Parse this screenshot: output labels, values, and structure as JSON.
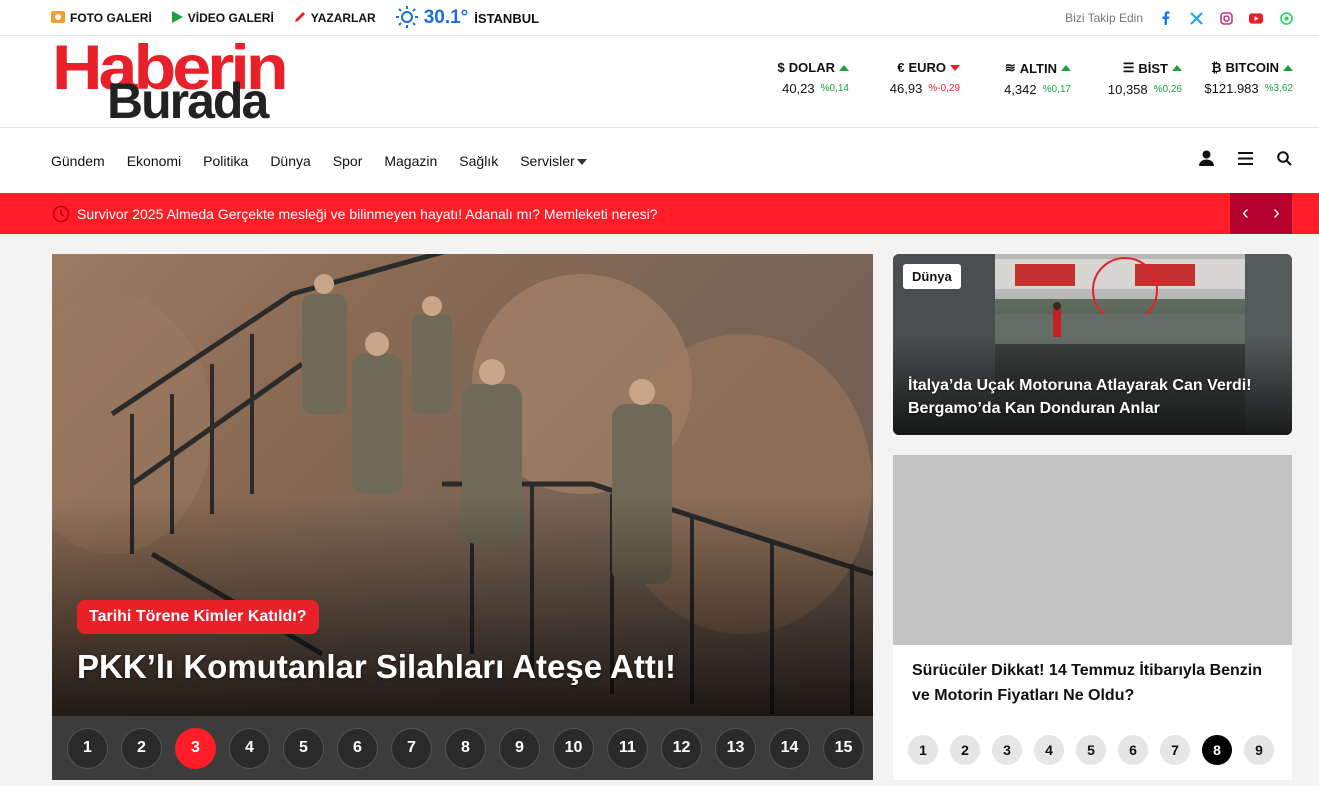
{
  "topbar": {
    "foto_galeri": "FOTO GALERİ",
    "video_galeri": "VİDEO GALERİ",
    "yazarlar": "YAZARLAR",
    "temperature": "30.1°",
    "city": "İSTANBUL",
    "follow": "Bizi Takip Edin",
    "social_icons": [
      "facebook-icon",
      "x-icon",
      "instagram-icon",
      "youtube-icon",
      "whatsapp-icon"
    ]
  },
  "logo": {
    "line1": "Haberin",
    "line2": "Burada"
  },
  "markets": [
    {
      "name": "DOLAR",
      "symbol": "$",
      "value": "40,23",
      "change": "%0,14",
      "dir": "up"
    },
    {
      "name": "EURO",
      "symbol": "€",
      "value": "46,93",
      "change": "%-0,29",
      "dir": "down"
    },
    {
      "name": "ALTIN",
      "symbol": "≋",
      "value": "4,342",
      "change": "%0,17",
      "dir": "up"
    },
    {
      "name": "BİST",
      "symbol": "☰",
      "value": "10,358",
      "change": "%0,26",
      "dir": "up"
    },
    {
      "name": "BITCOIN",
      "symbol": "₿",
      "value": "$121.983",
      "change": "%3,62",
      "dir": "up"
    }
  ],
  "nav": {
    "items": [
      "Gündem",
      "Ekonomi",
      "Politika",
      "Dünya",
      "Spor",
      "Magazin",
      "Sağlık",
      "Servisler"
    ]
  },
  "ticker": {
    "text": "Survivor 2025 Almeda Gerçekte mesleği ve bilinmeyen hayatı! Adanalı mı? Memleketi neresi?",
    "prev": "‹",
    "next": "›"
  },
  "hero": {
    "category": "Tarihi Törene Kimler Katıldı?",
    "title": "PKK’lı Komutanlar Silahları Ateşe Attı!",
    "pages": [
      "1",
      "2",
      "3",
      "4",
      "5",
      "6",
      "7",
      "8",
      "9",
      "10",
      "11",
      "12",
      "13",
      "14",
      "15"
    ],
    "active_page": "3"
  },
  "side_card_1": {
    "category": "Dünya",
    "title": "İtalya’da Uçak Motoruna Atlayarak Can Verdi! Bergamo’da Kan Donduran Anlar"
  },
  "side_card_2": {
    "title": "Sürücüler Dikkat! 14 Temmuz İtibarıyla Benzin ve Motorin Fiyatları Ne Oldu?",
    "pages": [
      "1",
      "2",
      "3",
      "4",
      "5",
      "6",
      "7",
      "8",
      "9"
    ],
    "active_page": "8"
  },
  "colors": {
    "brand_red": "#ff1e27",
    "ticker_dark": "#b3002f",
    "up_green": "#1ba043"
  }
}
